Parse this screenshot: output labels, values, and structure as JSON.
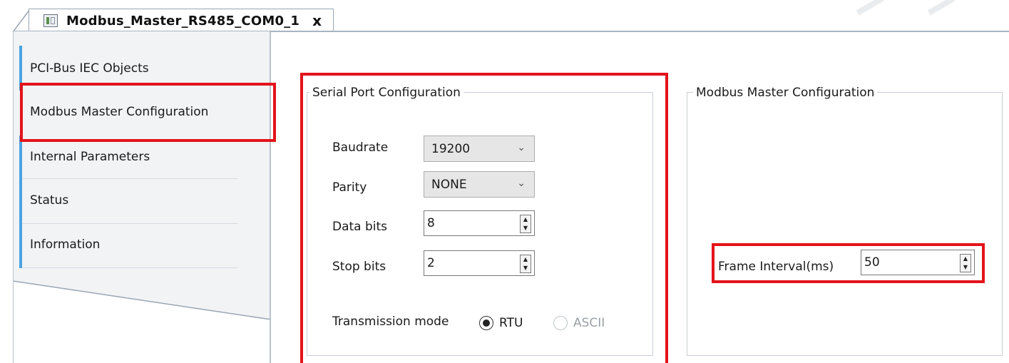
{
  "tab": {
    "title": "Modbus_Master_RS485_COM0_1",
    "close_glyph": "x"
  },
  "nav": {
    "items": [
      {
        "label": "PCI-Bus IEC Objects"
      },
      {
        "label": "Modbus Master Configuration"
      },
      {
        "label": "Internal Parameters"
      },
      {
        "label": "Status"
      },
      {
        "label": "Information"
      }
    ],
    "accent_color": "#4aa3e0"
  },
  "serial": {
    "title": "Serial Port Configuration",
    "baudrate_label": "Baudrate",
    "baudrate_value": "19200",
    "parity_label": "Parity",
    "parity_value": "NONE",
    "databits_label": "Data bits",
    "databits_value": "8",
    "stopbits_label": "Stop bits",
    "stopbits_value": "2",
    "transmission_label": "Transmission mode",
    "rtu_label": "RTU",
    "ascii_label": "ASCII"
  },
  "master": {
    "title": "Modbus Master Configuration",
    "frame_interval_label": "Frame Interval(ms)",
    "frame_interval_value": "50"
  },
  "colors": {
    "highlight": "#e3131a",
    "border": "#c9ced4"
  },
  "icons": {
    "device": "device-icon",
    "close": "close-icon",
    "chevron": "chevron-down-icon",
    "spin": "spin-arrows-icon"
  }
}
